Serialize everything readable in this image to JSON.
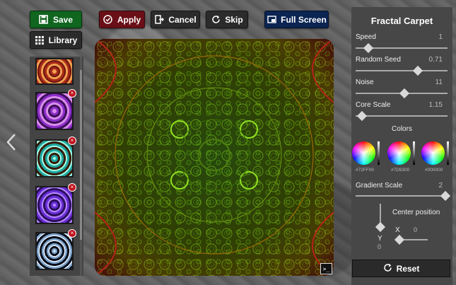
{
  "toolbar": {
    "save_label": "Save",
    "library_label": "Library",
    "apply_label": "Apply",
    "cancel_label": "Cancel",
    "skip_label": "Skip",
    "fullscreen_label": "Full Screen"
  },
  "library": {
    "thumbnails": [
      {
        "name": "orange-fractal",
        "color": "#d4572b"
      },
      {
        "name": "purple-fractal",
        "color": "#8d2fc9"
      },
      {
        "name": "teal-fractal",
        "color": "#21a7a0"
      },
      {
        "name": "violet-fractal",
        "color": "#6a2fd9"
      },
      {
        "name": "blue-fractal",
        "color": "#7aa0c8"
      }
    ],
    "scroll_position": 0.06
  },
  "canvas": {
    "terminal_label": ">_"
  },
  "panel": {
    "title": "Fractal Carpet",
    "speed": {
      "label": "Speed",
      "value": "1",
      "fraction": 0.14
    },
    "random_seed": {
      "label": "Random Seed",
      "value": "0.71",
      "fraction": 0.68
    },
    "noise": {
      "label": "Noise",
      "value": "11",
      "fraction": 0.53
    },
    "core_scale": {
      "label": "Core Scale",
      "value": "1.15",
      "fraction": 0.07
    },
    "colors_label": "Colors",
    "colors": [
      {
        "hex": "#72FF00"
      },
      {
        "hex": "#7D9300"
      },
      {
        "hex": "#000000"
      }
    ],
    "gradient_scale": {
      "label": "Gradient Scale",
      "value": "2",
      "fraction": 0.98
    },
    "center_label": "Center position",
    "x_label": "X",
    "x_value": "0",
    "y_label": "Y",
    "y_value": "0",
    "reset_label": "Reset"
  }
}
